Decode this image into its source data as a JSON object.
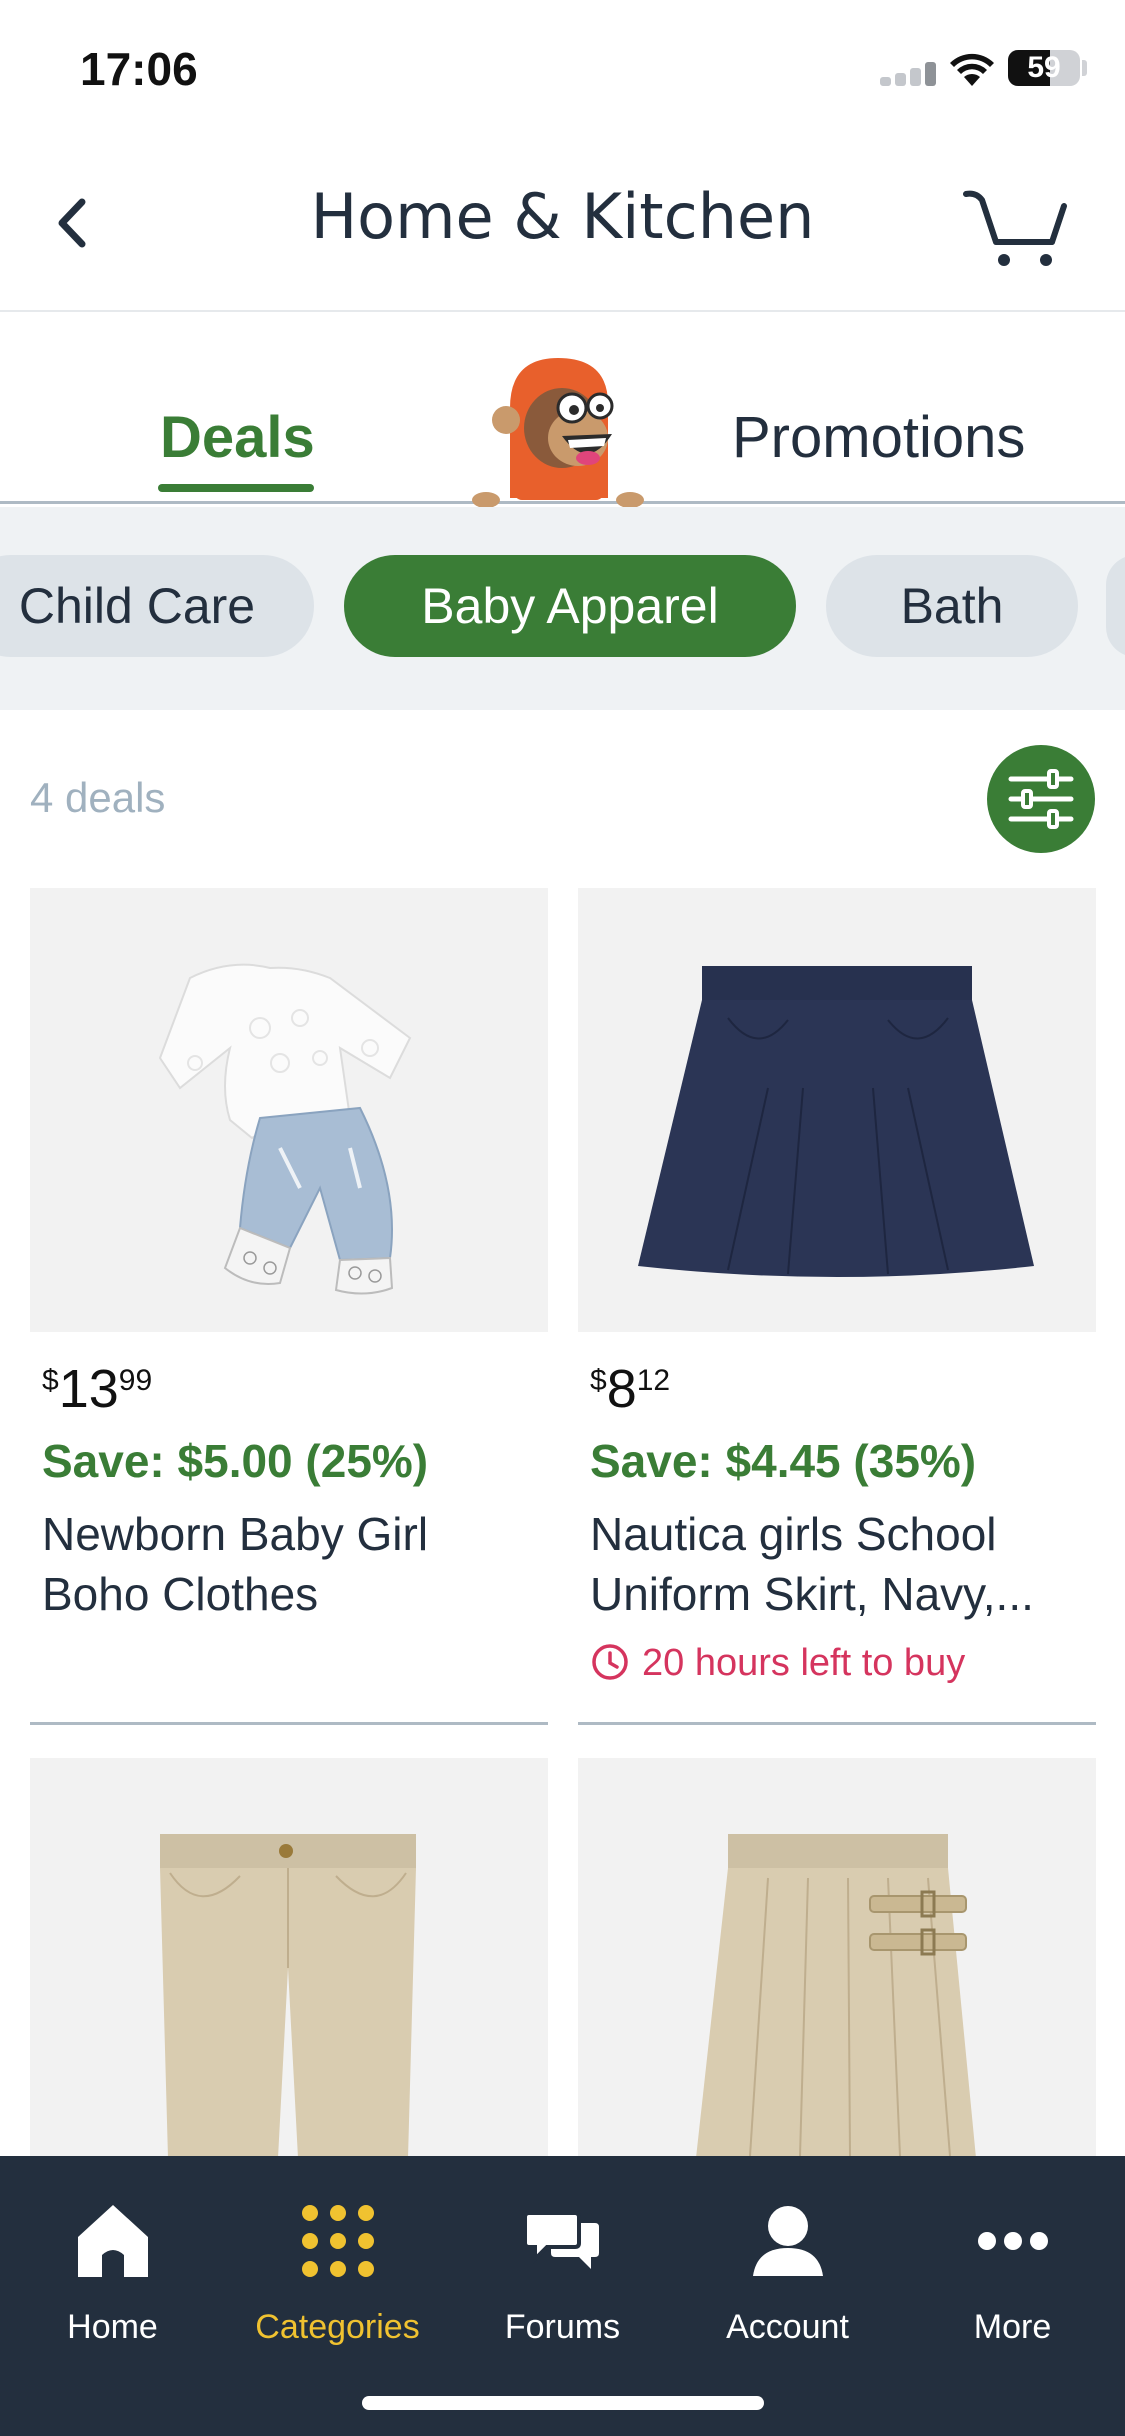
{
  "status_bar": {
    "time": "17:06",
    "battery": "59",
    "battery_level": 0.59
  },
  "header": {
    "title": "Home & Kitchen"
  },
  "tabs": [
    {
      "label": "Deals",
      "active": true
    },
    {
      "label": "Promotions",
      "active": false
    }
  ],
  "chips": [
    {
      "label": "Child Care",
      "selected": false
    },
    {
      "label": "Baby Apparel",
      "selected": true
    },
    {
      "label": "Bath",
      "selected": false
    }
  ],
  "deals_count": "4 deals",
  "products": [
    {
      "price_symbol": "$",
      "price_whole": "13",
      "price_fraction": "99",
      "save": "Save: $5.00 (25%)",
      "title": "Newborn Baby Girl Boho Clothes",
      "timer": ""
    },
    {
      "price_symbol": "$",
      "price_whole": "8",
      "price_fraction": "12",
      "save": "Save: $4.45 (35%)",
      "title_line1": "Nautica girls School",
      "title_line2": "Uniform Skirt, Navy,...",
      "timer": "20 hours left to buy"
    },
    {
      "image": "khaki-shorts"
    },
    {
      "image": "khaki-pleated-skirt"
    }
  ],
  "bottom_nav": [
    {
      "label": "Home",
      "icon": "home-icon",
      "active": false
    },
    {
      "label": "Categories",
      "icon": "grid-icon",
      "active": true
    },
    {
      "label": "Forums",
      "icon": "chat-icon",
      "active": false
    },
    {
      "label": "Account",
      "icon": "person-icon",
      "active": false
    },
    {
      "label": "More",
      "icon": "more-icon",
      "active": false
    }
  ],
  "colors": {
    "accent_green": "#3a7d36",
    "navy": "#232f3e",
    "timer_pink": "#d5345e",
    "nav_active": "#f0c230"
  }
}
